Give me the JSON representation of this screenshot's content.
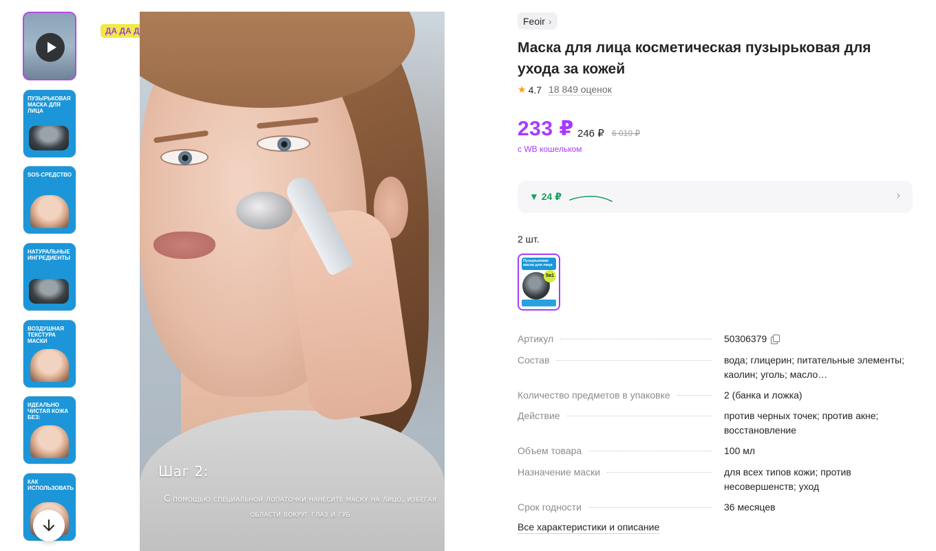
{
  "badge": "ДА ДА ДА",
  "thumbnails": [
    {
      "kind": "video",
      "label": ""
    },
    {
      "kind": "image",
      "label": "Пузырьковая маска для лица"
    },
    {
      "kind": "image",
      "label": "SOS-средство"
    },
    {
      "kind": "image",
      "label": "Натуральные ингредиенты"
    },
    {
      "kind": "image",
      "label": "Воздушная текстура маски"
    },
    {
      "kind": "image",
      "label": "Идеально чистая кожа без:"
    },
    {
      "kind": "image",
      "label": "Как использовать"
    }
  ],
  "video": {
    "step": "Шаг 2:",
    "caption": "С помощью специальной лопаточки нанесите маску на лицо, избегая области вокруг глаз и губ"
  },
  "product": {
    "brand": "Feoir",
    "title": "Маска для лица косметическая пузырьковая для ухода за кожей",
    "rating": "4.7",
    "reviews": "18 849 оценок",
    "price_wallet": "233 ₽",
    "price": "246 ₽",
    "price_old": "6 010 ₽",
    "wallet_note": "с WB кошельком",
    "price_drop": "▼ 24 ₽",
    "quantity": "2 шт.",
    "variant_thumb_title": "Пузырьковая маска для лица",
    "variant_badge": "5в1"
  },
  "specs": [
    {
      "name": "Артикул",
      "value": "50306379",
      "copy": true
    },
    {
      "name": "Состав",
      "value": "вода; глицерин; питательные элементы; каолин; уголь; масло…"
    },
    {
      "name": "Количество предметов в упаковке",
      "value": "2 (банка и ложка)"
    },
    {
      "name": "Действие",
      "value": "против черных точек; против акне; восстановление"
    },
    {
      "name": "Объем товара",
      "value": "100 мл"
    },
    {
      "name": "Назначение маски",
      "value": "для всех типов кожи; против несовершенств; уход"
    },
    {
      "name": "Срок годности",
      "value": "36 месяцев"
    }
  ],
  "all_specs_link": "Все характеристики и описание",
  "colors": {
    "accent": "#a73afd",
    "price_drop": "#14a05a",
    "badge_bg": "#f0e94c",
    "thumb_blue": "#1c96d8"
  }
}
